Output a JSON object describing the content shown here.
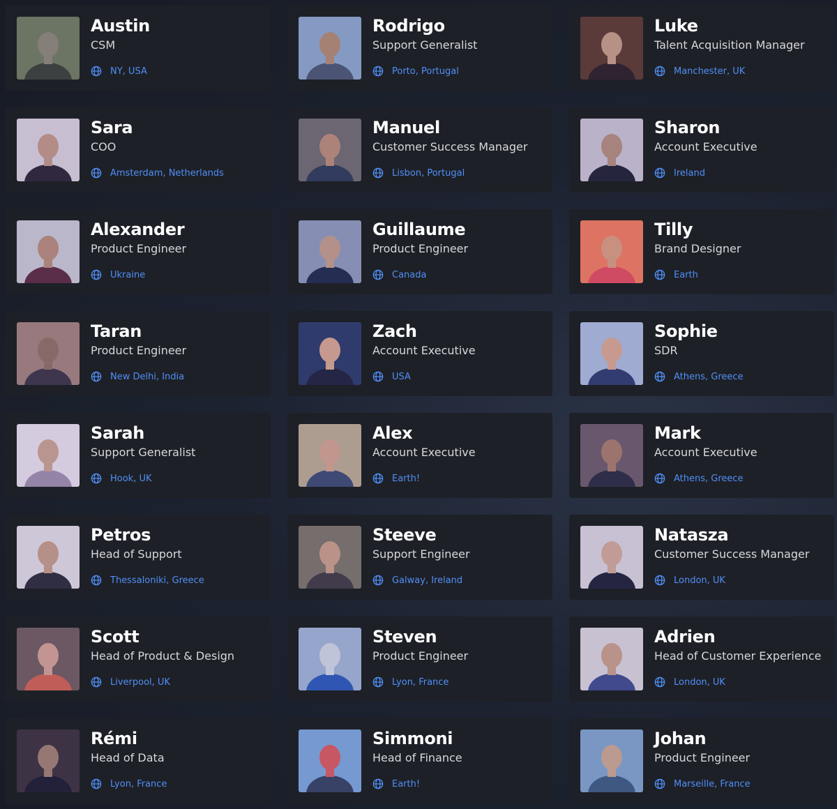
{
  "team": [
    {
      "name": "Austin",
      "role": "CSM",
      "location": "NY, USA",
      "photo": [
        "#6f7c5c",
        "#8d8674",
        "#3a3f33"
      ]
    },
    {
      "name": "Rodrigo",
      "role": "Support Generalist",
      "location": "Porto, Portugal",
      "photo": [
        "#8ba6c8",
        "#b0896e",
        "#4a5670"
      ]
    },
    {
      "name": "Luke",
      "role": "Talent Acquisition Manager",
      "location": "Manchester, UK",
      "photo": [
        "#5b3a2c",
        "#c49a82",
        "#2b1e22"
      ]
    },
    {
      "name": "Sara",
      "role": "COO",
      "location": "Amsterdam, Netherlands",
      "photo": [
        "#d6cfd8",
        "#c09684",
        "#2a2430"
      ]
    },
    {
      "name": "Manuel",
      "role": "Customer Success Manager",
      "location": "Lisbon, Portugal",
      "photo": [
        "#6e6a6c",
        "#b88a74",
        "#2c3a55"
      ]
    },
    {
      "name": "Sharon",
      "role": "Account Executive",
      "location": "Ireland",
      "photo": [
        "#c6c1cf",
        "#b28b78",
        "#1f2030"
      ]
    },
    {
      "name": "Alexander",
      "role": "Product Engineer",
      "location": "Ukraine",
      "photo": [
        "#c8c6d0",
        "#b68a76",
        "#5b2a3d"
      ]
    },
    {
      "name": "Guillaume",
      "role": "Product Engineer",
      "location": "Canada",
      "photo": [
        "#8d99b6",
        "#c09a86",
        "#1f2a48"
      ]
    },
    {
      "name": "Tilly",
      "role": "Brand Designer",
      "location": "Earth",
      "photo": [
        "#f07a5a",
        "#d89a7a",
        "#e04a5a"
      ]
    },
    {
      "name": "Taran",
      "role": "Product Engineer",
      "location": "New Delhi, India",
      "photo": [
        "#a18078",
        "#8e6e60",
        "#3a3442"
      ]
    },
    {
      "name": "Zach",
      "role": "Account Executive",
      "location": "USA",
      "photo": [
        "#2b3a66",
        "#d4a48a",
        "#1e2238"
      ]
    },
    {
      "name": "Sophie",
      "role": "SDR",
      "location": "Athens, Greece",
      "photo": [
        "#a9b9d8",
        "#d6a68e",
        "#2e3b6a"
      ]
    },
    {
      "name": "Sarah",
      "role": "Support Generalist",
      "location": "Hook, UK",
      "photo": [
        "#e5dde6",
        "#c8a08c",
        "#9c8ca8"
      ]
    },
    {
      "name": "Alex",
      "role": "Account Executive",
      "location": "Earth!",
      "photo": [
        "#b9a88e",
        "#cfa18a",
        "#3b4a6e"
      ]
    },
    {
      "name": "Mark",
      "role": "Account Executive",
      "location": "Athens, Greece",
      "photo": [
        "#6b5a66",
        "#a67a66",
        "#2a2b3e"
      ]
    },
    {
      "name": "Petros",
      "role": "Head of Support",
      "location": "Thessaloniki, Greece",
      "photo": [
        "#dfd9df",
        "#c29a86",
        "#2b2b36"
      ]
    },
    {
      "name": "Steeve",
      "role": "Support Engineer",
      "location": "Galway, Ireland",
      "photo": [
        "#7a7266",
        "#c89c84",
        "#3e3a40"
      ]
    },
    {
      "name": "Natasza",
      "role": "Customer Success Manager",
      "location": "London, UK",
      "photo": [
        "#d8d2da",
        "#d0a894",
        "#1e2034"
      ]
    },
    {
      "name": "Scott",
      "role": "Head of Product & Design",
      "location": "Liverpool, UK",
      "photo": [
        "#6e5a5a",
        "#d2a090",
        "#d0604e"
      ]
    },
    {
      "name": "Steven",
      "role": "Product Engineer",
      "location": "Lyon, France",
      "photo": [
        "#9fb2d2",
        "#cfd5e0",
        "#2a58b4"
      ]
    },
    {
      "name": "Adrien",
      "role": "Head of Customer Experience",
      "location": "London, UK",
      "photo": [
        "#d6d2d8",
        "#c69c86",
        "#3d4a8a"
      ]
    },
    {
      "name": "Rémi",
      "role": "Head of Data",
      "location": "Lyon, France",
      "photo": [
        "#3a3038",
        "#a07e6e",
        "#1c1c2c"
      ]
    },
    {
      "name": "Simmoni",
      "role": "Head of Finance",
      "location": "Earth!",
      "photo": [
        "#7aa4d8",
        "#d65a5a",
        "#34405e"
      ]
    },
    {
      "name": "Johan",
      "role": "Product Engineer",
      "location": "Marseille, France",
      "photo": [
        "#7fa2c8",
        "#c9a58c",
        "#3c5a7e"
      ]
    }
  ],
  "colors": {
    "card_bg": "#1e2027",
    "name": "#ffffff",
    "role": "#d6d8de",
    "location": "#4f8ff7"
  }
}
